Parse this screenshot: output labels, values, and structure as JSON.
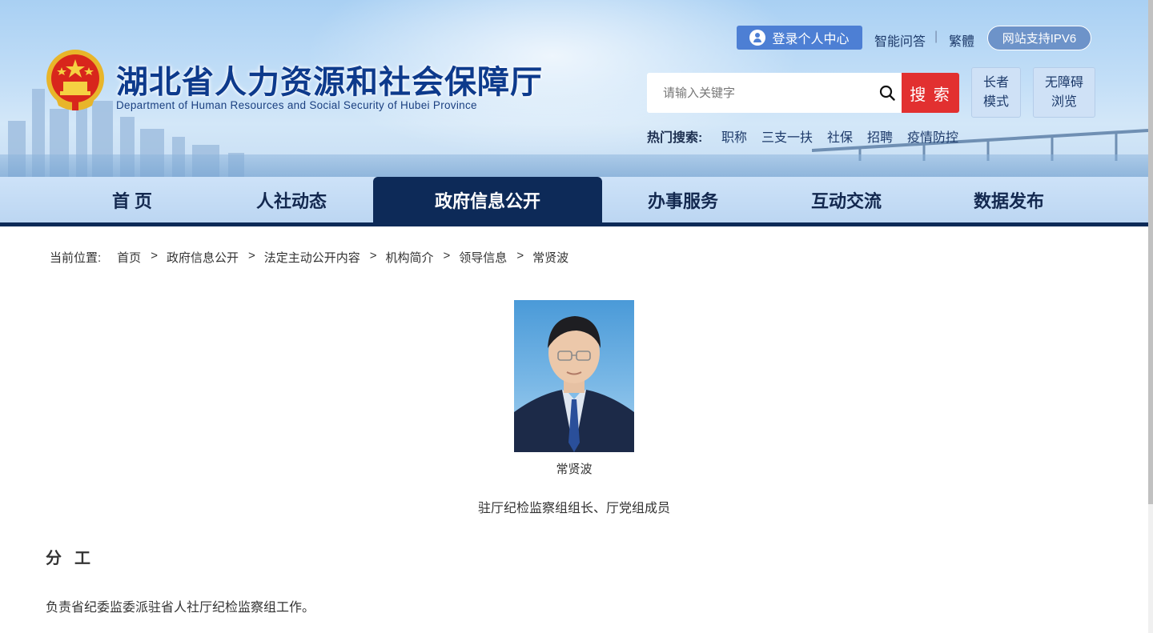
{
  "header": {
    "title": "湖北省人力资源和社会保障厅",
    "subtitle": "Department of Human Resources and Social Security of Hubei Province",
    "login_label": "登录个人中心",
    "qa_label": "智能问答",
    "separator": "|",
    "traditional_label": "繁體",
    "ipv6_label": "网站支持IPV6",
    "search": {
      "placeholder": "请输入关键字",
      "button_label": "搜 索"
    },
    "elder_mode": {
      "line1": "长者",
      "line2": "模式"
    },
    "accessible": {
      "line1": "无障碍",
      "line2": "浏览"
    },
    "hot_search": {
      "label": "热门搜索:",
      "items": [
        "职称",
        "三支一扶",
        "社保",
        "招聘",
        "疫情防控"
      ]
    }
  },
  "nav": {
    "items": [
      "首 页",
      "人社动态",
      "政府信息公开",
      "办事服务",
      "互动交流",
      "数据发布"
    ],
    "active_index": 2
  },
  "breadcrumb": {
    "label": "当前位置:",
    "items": [
      "首页",
      "政府信息公开",
      "法定主动公开内容",
      "机构简介",
      "领导信息",
      "常贤波"
    ],
    "separator": ">"
  },
  "profile": {
    "name": "常贤波",
    "position": "驻厅纪检监察组组长、厅党组成员",
    "duty_heading": "分工",
    "duty_text": "负责省纪委监委派驻省人社厅纪检监察组工作。"
  },
  "colors": {
    "nav_active": "#0d2a58",
    "search_button": "#e23030",
    "login_button": "#4d7fd4",
    "title_blue": "#0d3a8c"
  }
}
